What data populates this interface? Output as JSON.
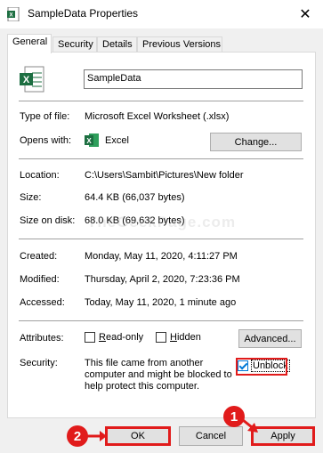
{
  "window": {
    "title": "SampleData Properties",
    "close_glyph": "✕"
  },
  "tabs": [
    {
      "label": "General",
      "active": true
    },
    {
      "label": "Security",
      "active": false
    },
    {
      "label": "Details",
      "active": false
    },
    {
      "label": "Previous Versions",
      "active": false
    }
  ],
  "file": {
    "name": "SampleData",
    "type_label": "Type of file:",
    "type_value": "Microsoft Excel Worksheet (.xlsx)",
    "opens_label": "Opens with:",
    "opens_value": "Excel",
    "change_button": "Change...",
    "location_label": "Location:",
    "location_value": "C:\\Users\\Sambit\\Pictures\\New folder",
    "size_label": "Size:",
    "size_value": "64.4 KB (66,037 bytes)",
    "size_disk_label": "Size on disk:",
    "size_disk_value": "68.0 KB (69,632 bytes)",
    "created_label": "Created:",
    "created_value": "Monday, May 11, 2020, 4:11:27 PM",
    "modified_label": "Modified:",
    "modified_value": "Thursday, April 2, 2020, 7:23:36 PM",
    "accessed_label": "Accessed:",
    "accessed_value": "Today, May 11, 2020, 1 minute ago"
  },
  "attributes": {
    "label": "Attributes:",
    "readonly_label": "Read-only",
    "readonly_checked": false,
    "hidden_label": "Hidden",
    "hidden_checked": false,
    "advanced_button": "Advanced..."
  },
  "security": {
    "label": "Security:",
    "line1": "This file came from another",
    "line2": "computer and might be blocked to",
    "line3": "help protect this computer.",
    "unblock_label": "Unblock",
    "unblock_checked": true
  },
  "footer": {
    "ok": "OK",
    "cancel": "Cancel",
    "apply": "Apply"
  },
  "annotations": {
    "badge_1": "1",
    "badge_2": "2",
    "color": "#e11b1b"
  },
  "watermark": "TheGeekPage.com",
  "colors": {
    "excel_green": "#1d6f42",
    "accent": "#0078d7"
  }
}
